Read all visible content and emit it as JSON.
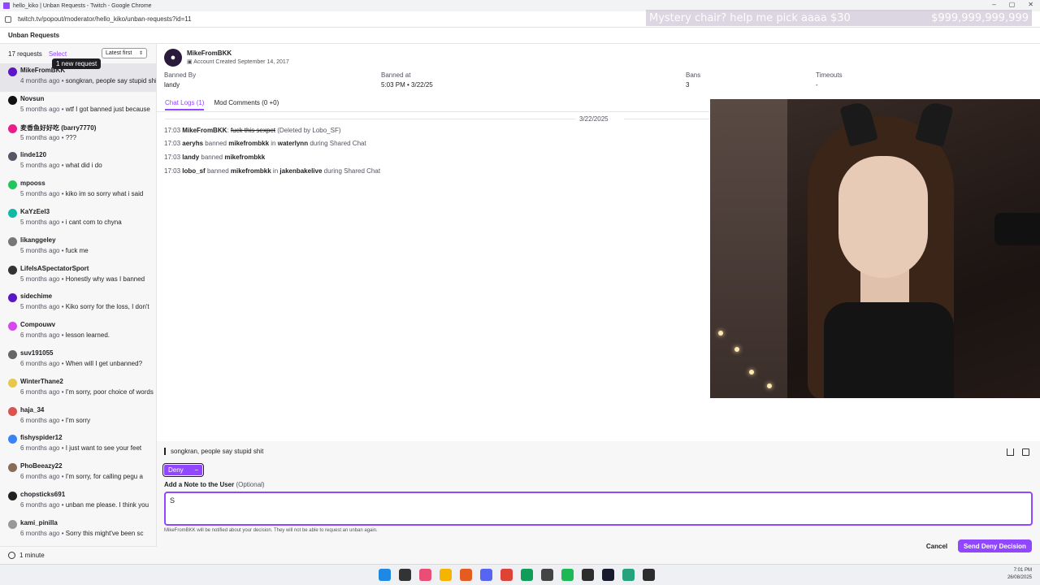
{
  "browser": {
    "tab_title": "hello_kiko | Unban Requests - Twitch - Google Chrome",
    "url": "twitch.tv/popout/moderator/hello_kiko/unban-requests?id=11",
    "window_controls": [
      "–",
      "▢",
      "✕"
    ]
  },
  "overlay": {
    "goal_text": "Mystery chair? help me pick aaaa $30",
    "amount": "$999,999,999,999"
  },
  "page": {
    "title": "Unban Requests"
  },
  "sidebar": {
    "count_label": "17 requests",
    "select_label": "Select",
    "sort_label": "Latest first",
    "tooltip": "1 new request",
    "footer_label": "1 minute",
    "requests": [
      {
        "name": "MikeFromBKK",
        "time": "4 months ago",
        "msg": "songkran, people say stupid shit",
        "color": "#5c16c5"
      },
      {
        "name": "Novsun",
        "time": "5 months ago",
        "msg": "wtf I got banned just because",
        "color": "#111111"
      },
      {
        "name": "麦香鱼好好吃 (barry7770)",
        "time": "5 months ago",
        "msg": "???",
        "color": "#e91e8c"
      },
      {
        "name": "linde120",
        "time": "5 months ago",
        "msg": "what did i do",
        "color": "#555566"
      },
      {
        "name": "mpooss",
        "time": "5 months ago",
        "msg": "kiko im so sorry what i said",
        "color": "#22c55e"
      },
      {
        "name": "KaYzEel3",
        "time": "5 months ago",
        "msg": "i cant com to chyna",
        "color": "#10b9a5"
      },
      {
        "name": "likanggeley",
        "time": "5 months ago",
        "msg": "fuck me",
        "color": "#777777"
      },
      {
        "name": "LifeIsASpectatorSport",
        "time": "5 months ago",
        "msg": "Honestly why was I banned",
        "color": "#333333"
      },
      {
        "name": "sidechime",
        "time": "5 months ago",
        "msg": "Kiko sorry for the loss, I don't",
        "color": "#5c16c5"
      },
      {
        "name": "Compouwv",
        "time": "6 months ago",
        "msg": "lesson learned.",
        "color": "#d946ef"
      },
      {
        "name": "suv191055",
        "time": "6 months ago",
        "msg": "When will I get unbanned?",
        "color": "#666666"
      },
      {
        "name": "WinterThane2",
        "time": "6 months ago",
        "msg": "I'm sorry, poor choice of words",
        "color": "#e6c84c"
      },
      {
        "name": "haja_34",
        "time": "6 months ago",
        "msg": "I'm sorry",
        "color": "#d9534f"
      },
      {
        "name": "fishyspider12",
        "time": "6 months ago",
        "msg": "I just want to see your feet",
        "color": "#3b82f6"
      },
      {
        "name": "PhoBeeazy22",
        "time": "6 months ago",
        "msg": "I'm sorry, for calling pegu a",
        "color": "#8a6a5a"
      },
      {
        "name": "chopsticks691",
        "time": "6 months ago",
        "msg": "unban me please. I think you",
        "color": "#222222"
      },
      {
        "name": "kami_pinilla",
        "time": "6 months ago",
        "msg": "Sorry this might've been sc",
        "color": "#999999"
      }
    ]
  },
  "detail": {
    "username": "MikeFromBKK",
    "account_created": "Account Created September 14, 2017",
    "banned_by_label": "Banned By",
    "banned_by": "landy",
    "banned_at_label": "Banned at",
    "banned_at": "5:03 PM • 3/22/25",
    "bans_label": "Bans",
    "bans": "3",
    "timeouts_label": "Timeouts",
    "timeouts": "-",
    "tab_chat_logs": "Chat Logs (1)",
    "tab_mod_comments": "Mod Comments (0 +0)",
    "date": "3/22/2025",
    "logs": [
      {
        "time": "17:03",
        "user": "MikeFromBKK",
        "sep": ":",
        "msg": "fuck this sexpet",
        "extra": "(Deleted by Lobo_SF)"
      },
      {
        "time": "17:03",
        "user": "aeryhs",
        "sep": "banned",
        "target": "mikefrombkk",
        "in": "in",
        "channel": "waterlynn",
        "tail": "during Shared Chat"
      },
      {
        "time": "17:03",
        "user": "landy",
        "sep": "banned",
        "target": "mikefrombkk"
      },
      {
        "time": "17:03",
        "user": "lobo_sf",
        "sep": "banned",
        "target": "mikefrombkk",
        "in": "in",
        "channel": "jakenbakelive",
        "tail": "during Shared Chat"
      }
    ]
  },
  "decision": {
    "reason": "songkran, people say stupid shit",
    "chip_label": "Deny",
    "chip_minus": "−",
    "note_label": "Add a Note to the User",
    "note_optional": "(Optional)",
    "note_value": "S",
    "notify_text": "MikeFromBKK will be notified about your decision. They will not be able to request an unban again.",
    "cancel_label": "Cancel",
    "send_label": "Send Deny Decision"
  },
  "taskbar": {
    "time": "7:01 PM",
    "date": "26/08/2025",
    "icon_colors": [
      "#1e88e5",
      "#333333",
      "#e94e77",
      "#f5b400",
      "#e45c1f",
      "#5865f2",
      "#db4437",
      "#0f9d58",
      "#444444",
      "#1db954",
      "#2d2d2d",
      "#1a1a2e",
      "#24a37c",
      "#2d2d2d"
    ]
  }
}
